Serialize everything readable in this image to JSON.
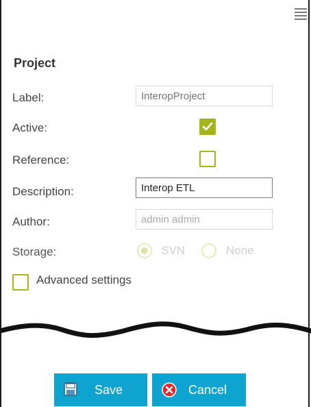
{
  "icons": {
    "menu": "hamburger-menu-icon",
    "checkmark": "checkmark-icon",
    "save": "floppy-disk-icon",
    "cancel": "cancel-x-icon"
  },
  "colors": {
    "accent": "#a4b41a",
    "button": "#0fa3d0",
    "cancel_red": "#e2262b"
  },
  "section": {
    "title": "Project"
  },
  "form": {
    "label": {
      "label": "Label:",
      "placeholder": "InteropProject"
    },
    "active": {
      "label": "Active:",
      "checked": true
    },
    "reference": {
      "label": "Reference:",
      "checked": false
    },
    "description": {
      "label": "Description:",
      "value": "Interop ETL"
    },
    "author": {
      "label": "Author:",
      "value": "admin admin"
    },
    "storage": {
      "label": "Storage:",
      "options": [
        "SVN",
        "None"
      ],
      "selected": "SVN"
    },
    "advanced": {
      "label": "Advanced settings",
      "checked": false
    }
  },
  "buttons": {
    "save": "Save",
    "cancel": "Cancel"
  }
}
